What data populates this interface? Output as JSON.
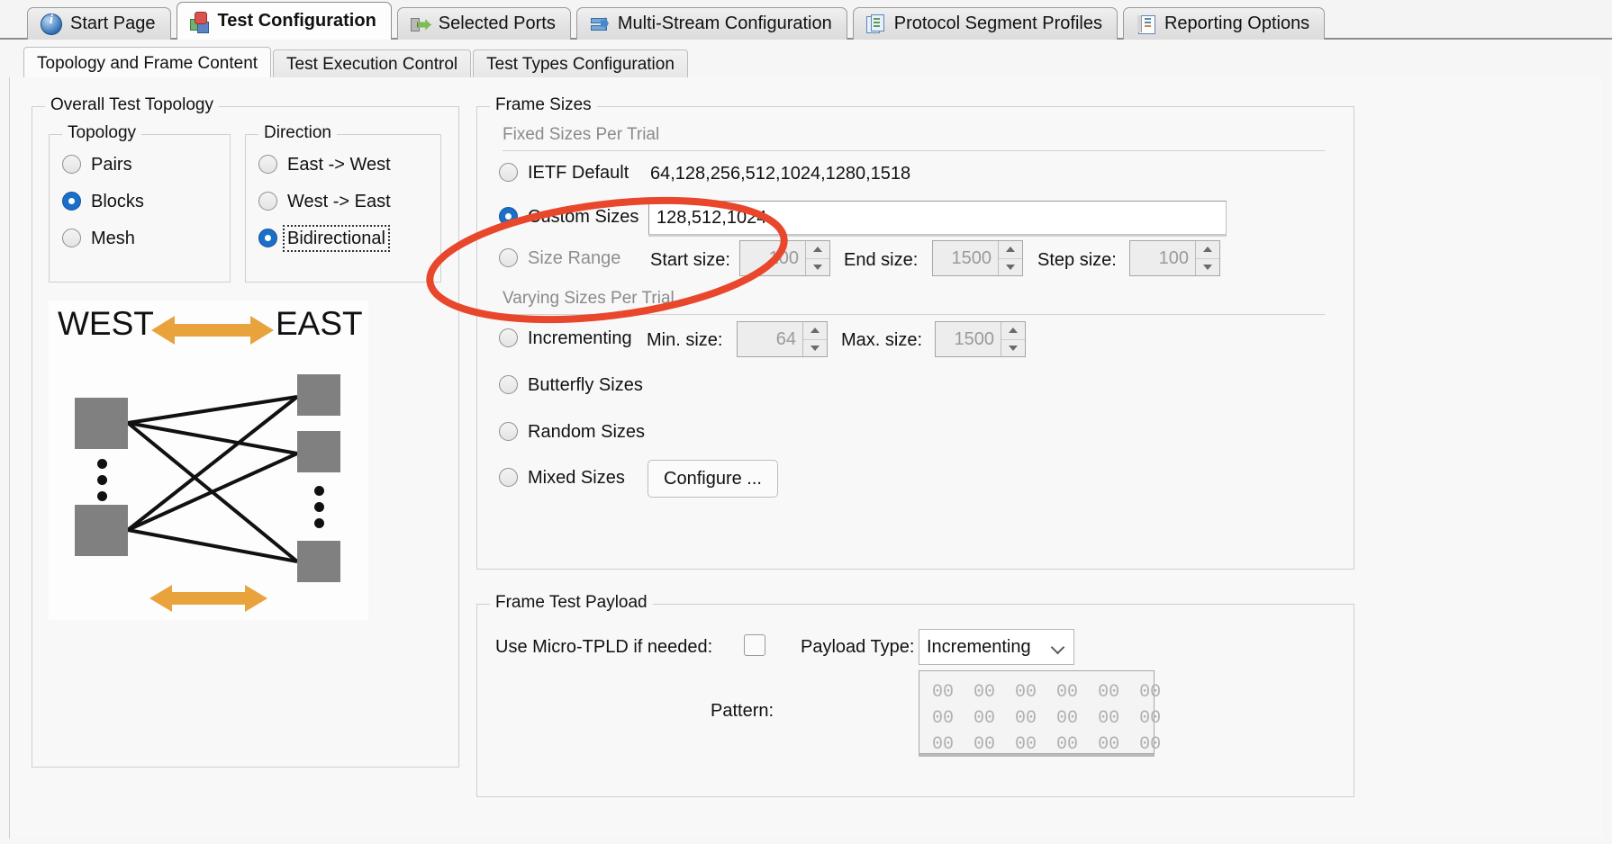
{
  "window": {
    "outer_tabs": [
      {
        "label": "Start Page",
        "icon": "info-icon",
        "active": false
      },
      {
        "label": "Test Configuration",
        "icon": "test-config-cube-icon",
        "active": true
      },
      {
        "label": "Selected Ports",
        "icon": "ports-icon",
        "active": false
      },
      {
        "label": "Multi-Stream Configuration",
        "icon": "stream-icon",
        "active": false
      },
      {
        "label": "Protocol Segment Profiles",
        "icon": "documents-icon",
        "active": false
      },
      {
        "label": "Reporting Options",
        "icon": "report-book-icon",
        "active": false
      }
    ],
    "inner_tabs": [
      {
        "label": "Topology and Frame Content",
        "active": true
      },
      {
        "label": "Test Execution Control",
        "active": false
      },
      {
        "label": "Test Types Configuration",
        "active": false
      }
    ]
  },
  "overall_test_topology": {
    "title": "Overall Test Topology",
    "topology": {
      "title": "Topology",
      "options": [
        "Pairs",
        "Blocks",
        "Mesh"
      ],
      "selected": "Blocks"
    },
    "direction": {
      "title": "Direction",
      "options": [
        "East -> West",
        "West -> East",
        "Bidirectional"
      ],
      "selected": "Bidirectional",
      "focused": "Bidirectional"
    },
    "diagram": {
      "west_label": "WEST",
      "east_label": "EAST",
      "arrow_color": "#e8a33d",
      "node_color": "#808080"
    }
  },
  "frame_sizes": {
    "title": "Frame Sizes",
    "fixed_section_label": "Fixed Sizes Per Trial",
    "varying_section_label": "Varying Sizes Per Trial",
    "ietf_default": {
      "label": "IETF Default",
      "value": "64,128,256,512,1024,1280,1518",
      "selected": false
    },
    "custom_sizes": {
      "label": "Custom Sizes",
      "value": "128,512,1024",
      "selected": true
    },
    "size_range": {
      "label": "Size Range",
      "selected": false,
      "start_label": "Start size:",
      "start_value": "100",
      "end_label": "End size:",
      "end_value": "1500",
      "step_label": "Step size:",
      "step_value": "100"
    },
    "incrementing": {
      "label": "Incrementing",
      "selected": false,
      "min_label": "Min. size:",
      "min_value": "64",
      "max_label": "Max. size:",
      "max_value": "1500"
    },
    "butterfly": {
      "label": "Butterfly Sizes",
      "selected": false
    },
    "random": {
      "label": "Random Sizes",
      "selected": false
    },
    "mixed": {
      "label": "Mixed Sizes",
      "selected": false,
      "configure_button": "Configure ..."
    }
  },
  "frame_test_payload": {
    "title": "Frame Test Payload",
    "micro_tpld_label": "Use Micro-TPLD if needed:",
    "micro_tpld_checked": false,
    "payload_type_label": "Payload Type:",
    "payload_type_value": "Incrementing",
    "pattern_label": "Pattern:",
    "pattern_rows": [
      [
        "00",
        "00",
        "00",
        "00",
        "00",
        "00"
      ],
      [
        "00",
        "00",
        "00",
        "00",
        "00",
        "00"
      ],
      [
        "00",
        "00",
        "00",
        "00",
        "00",
        "00"
      ]
    ]
  },
  "annotation": {
    "shape": "ellipse-highlight",
    "color": "#e8472b",
    "targets": "custom-sizes-row"
  }
}
